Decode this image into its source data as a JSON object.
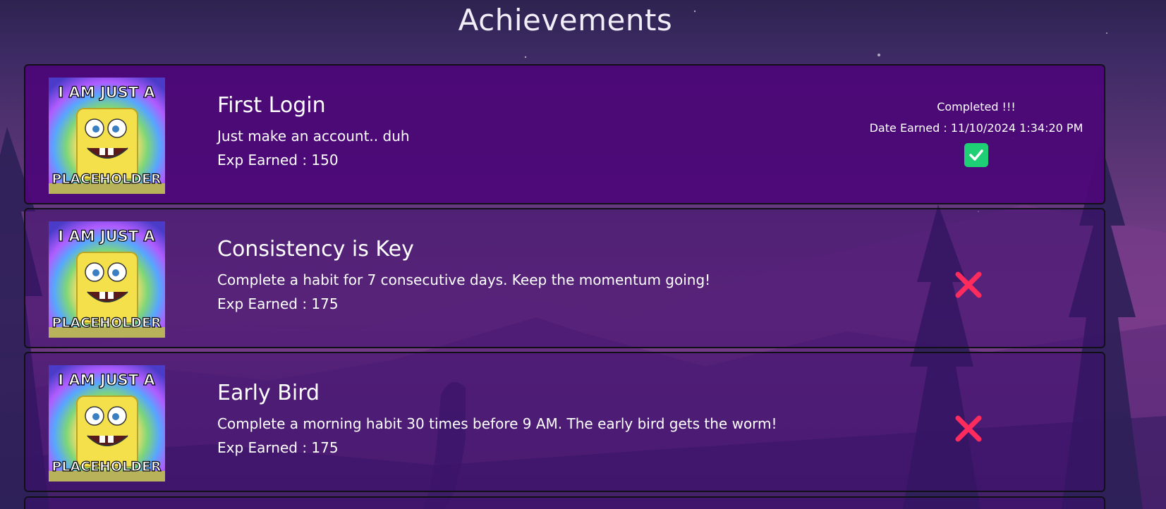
{
  "page": {
    "title": "Achievements"
  },
  "colors": {
    "completed_card_bg": "#4c0878",
    "locked_card_bg": "#3c0e6e",
    "check_green": "#1fcf76",
    "x_red": "#ff2b5c"
  },
  "achievements": [
    {
      "title": "First Login",
      "description": "Just make an account.. duh",
      "exp": "Exp Earned : 150",
      "completed": true,
      "status_label": "Completed !!!",
      "date_earned": "Date Earned : 11/10/2024 1:34:20 PM",
      "image_text_top": "I AM JUST A",
      "image_text_bottom": "PLACEHOLDER",
      "status_icon": "check-icon"
    },
    {
      "title": "Consistency is Key",
      "description": "Complete a habit for 7 consecutive days. Keep the momentum going!",
      "exp": "Exp Earned : 175",
      "completed": false,
      "image_text_top": "I AM JUST A",
      "image_text_bottom": "PLACEHOLDER",
      "status_icon": "x-icon"
    },
    {
      "title": "Early Bird",
      "description": "Complete a morning habit 30 times before 9 AM. The early bird gets the worm!",
      "exp": "Exp Earned : 175",
      "completed": false,
      "image_text_top": "I AM JUST A",
      "image_text_bottom": "PLACEHOLDER",
      "status_icon": "x-icon"
    }
  ]
}
